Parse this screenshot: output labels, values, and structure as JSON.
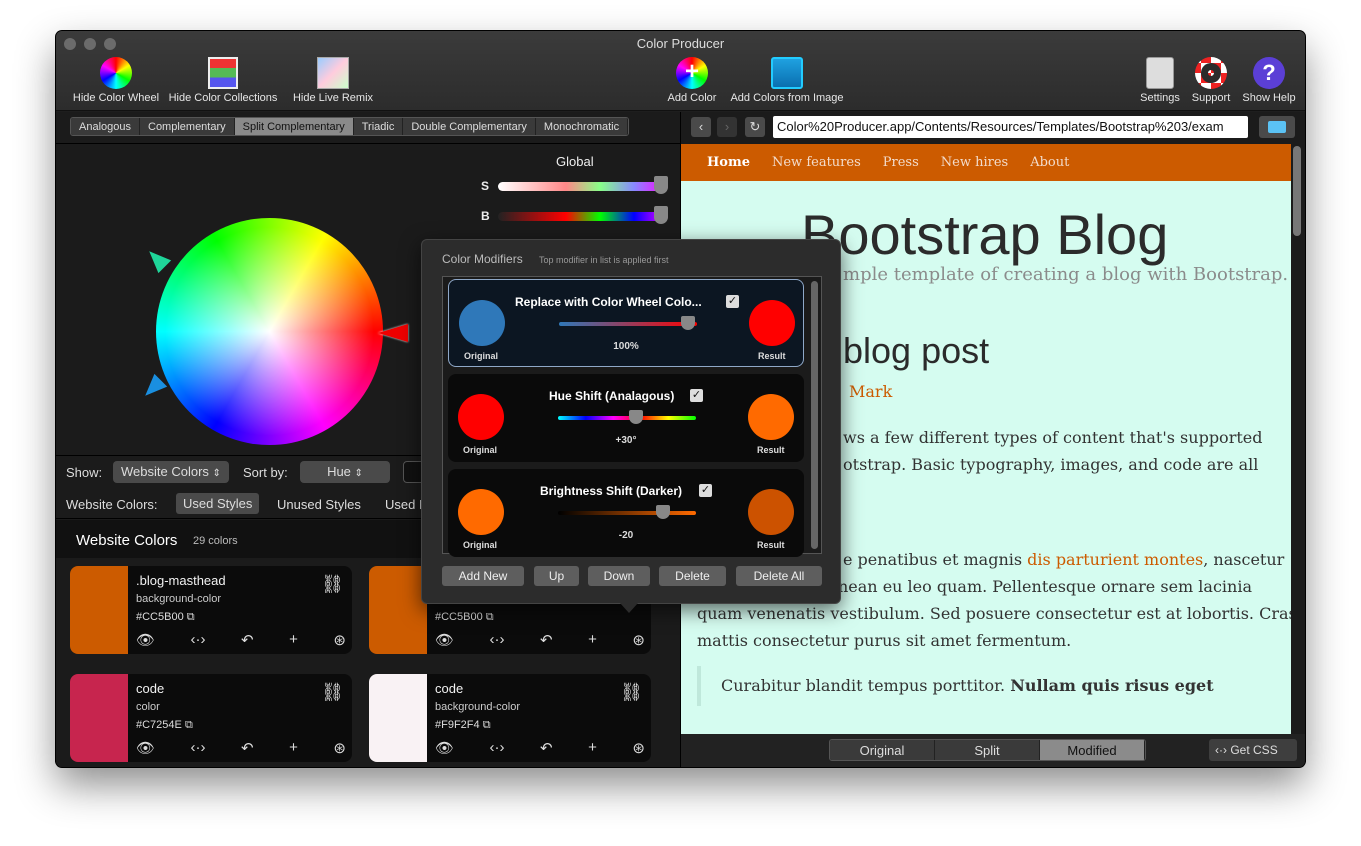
{
  "window": {
    "title": "Color Producer"
  },
  "toolbar": {
    "hide_color_wheel": "Hide Color Wheel",
    "hide_color_collections": "Hide Color Collections",
    "hide_live_remix": "Hide Live Remix",
    "add_color": "Add Color",
    "add_colors_from_image": "Add Colors from Image",
    "settings": "Settings",
    "support": "Support",
    "show_help": "Show Help"
  },
  "harmony_tabs": [
    "Analogous",
    "Complementary",
    "Split Complementary",
    "Triadic",
    "Double Complementary",
    "Monochromatic"
  ],
  "harmony_selected": "Split Complementary",
  "global": {
    "label": "Global",
    "s_label": "S",
    "b_label": "B"
  },
  "show_bar": {
    "show_label": "Show:",
    "show_value": "Website Colors",
    "sort_label": "Sort by:",
    "sort_value": "Hue"
  },
  "website_colors_bar": {
    "label": "Website Colors:",
    "used": "Used Styles",
    "unused": "Unused Styles",
    "used_partial": "Used R"
  },
  "website_colors_header": {
    "title": "Website Colors",
    "count": "29 colors"
  },
  "cards": [
    {
      "name": ".blog-masthead",
      "prop": "background-color",
      "hex": "#CC5B00",
      "color": "#CC5B00"
    },
    {
      "name": "",
      "prop": "",
      "hex": "#CC5B00",
      "color": "#CC5B00"
    },
    {
      "name": "code",
      "prop": "color",
      "hex": "#C7254E",
      "color": "#C7254E"
    },
    {
      "name": "code",
      "prop": "background-color",
      "hex": "#F9F2F4",
      "color": "#F9F2F4"
    }
  ],
  "browser": {
    "url": "Color%20Producer.app/Contents/Resources/Templates/Bootstrap%203/exam"
  },
  "site": {
    "nav": [
      "Home",
      "New features",
      "Press",
      "New hires",
      "About"
    ],
    "title": "Bootstrap Blog",
    "description": "mple template of creating a blog with Bootstrap.",
    "post_title": "blog post",
    "post_meta": "Mark",
    "post_p1_line1": "ws a few different types of content that's supported",
    "post_p1_line2": "otstrap. Basic typography, images, and code are all",
    "post_p2_line1_pre": "e penatibus et magnis ",
    "post_p2_link": "dis parturient montes",
    "post_p2_line1_post": ", nascetur",
    "post_p2_line2": "ridiculus mus. Aenean eu leo quam. Pellentesque ornare sem lacinia",
    "post_p2_line3": "quam venenatis vestibulum. Sed posuere consectetur est at lobortis. Cras",
    "post_p2_line4": "mattis consectetur purus sit amet fermentum.",
    "quote": "Curabitur blandit tempus porttitor.",
    "quote_bold": "Nullam quis risus eget"
  },
  "view_modes": [
    "Original",
    "Split",
    "Modified"
  ],
  "view_selected": "Modified",
  "get_css": "Get CSS",
  "modifiers": {
    "title": "Color Modifiers",
    "subtitle": "Top modifier in list is applied first",
    "items": [
      {
        "title": "Replace with Color Wheel Colo...",
        "value": "100%",
        "original": "#2f78b9",
        "result": "#ff0000"
      },
      {
        "title": "Hue Shift (Analagous)",
        "value": "+30°",
        "original": "#ff0000",
        "result": "#ff6a00"
      },
      {
        "title": "Brightness Shift (Darker)",
        "value": "-20",
        "original": "#ff6a00",
        "result": "#cc5200"
      }
    ],
    "original_label": "Original",
    "result_label": "Result",
    "buttons": {
      "add_new": "Add New",
      "up": "Up",
      "down": "Down",
      "delete": "Delete",
      "delete_all": "Delete All"
    }
  }
}
